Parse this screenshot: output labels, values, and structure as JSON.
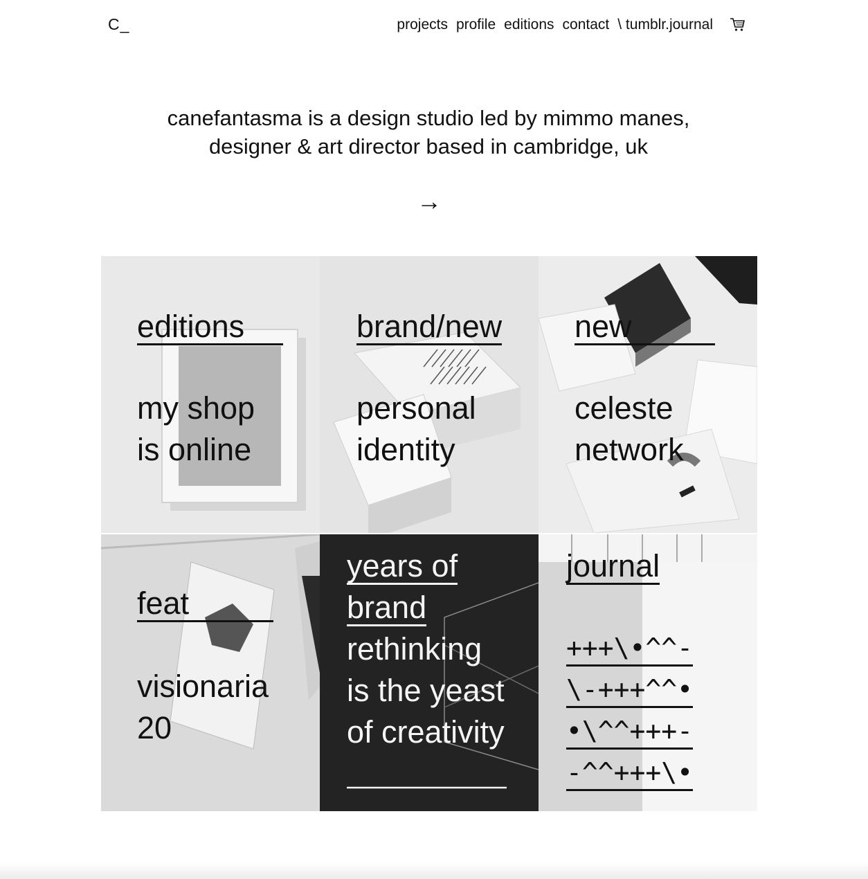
{
  "header": {
    "logo": "C_",
    "nav": [
      "projects",
      "profile",
      "editions",
      "contact",
      "\\ tumblr.journal"
    ],
    "cart_icon": "cart-icon"
  },
  "intro": {
    "line1": "canefantasma is a design studio led by mimmo manes,",
    "line2": "designer & art director based in cambridge, uk",
    "arrow": "→"
  },
  "tiles": [
    {
      "tag": "editions",
      "line1": "my shop",
      "line2": "is online"
    },
    {
      "tag": "brand/new",
      "line1": "personal",
      "line2": "identity"
    },
    {
      "tag": "new",
      "line1": "celeste",
      "line2": "network"
    },
    {
      "tag": "feat",
      "line1": "visionaria",
      "line2": "20"
    },
    {
      "lines": [
        "years of",
        "brand",
        "rethinking",
        "is the yeast",
        "of creativity"
      ]
    },
    {
      "tag": "journal",
      "lines": [
        "+++\\•^^-",
        "\\-+++^^•",
        "•\\^^+++-",
        "-^^+++\\•"
      ]
    }
  ],
  "colors": {
    "text": "#111111",
    "dark_tile": "#232323",
    "tile_light": "#e6e6e6"
  }
}
